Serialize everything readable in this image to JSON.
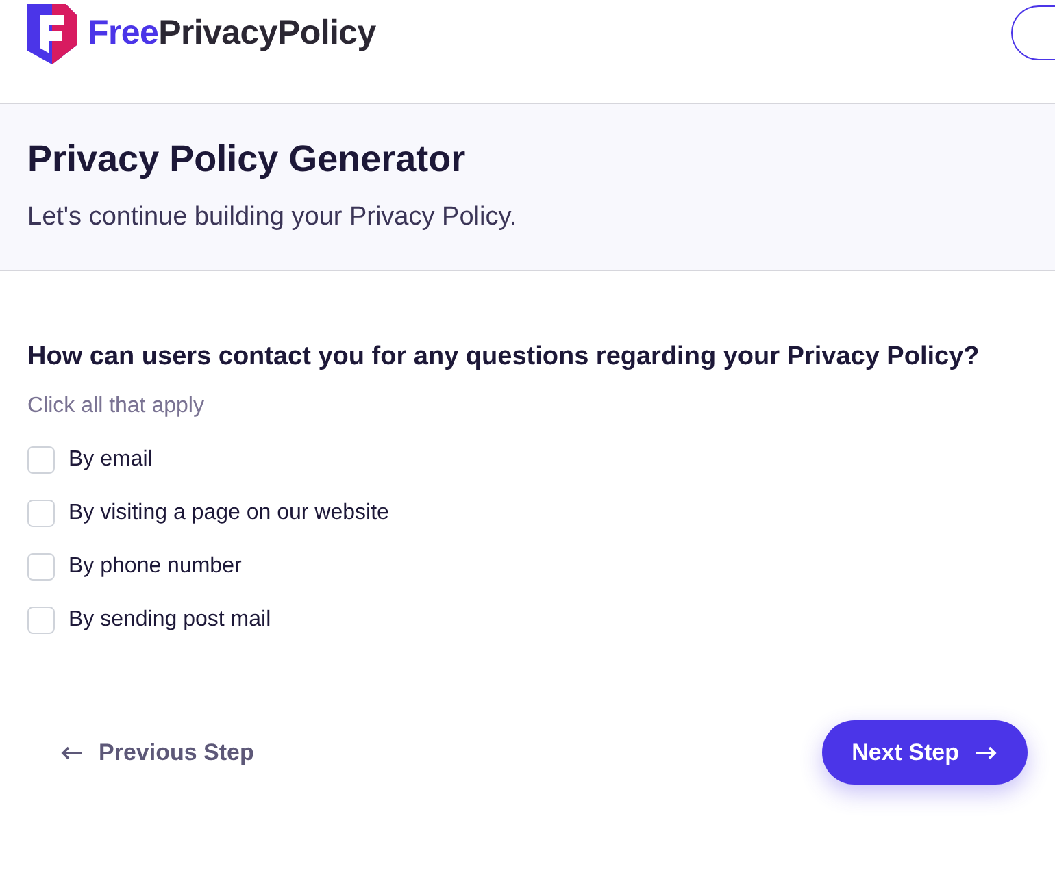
{
  "header": {
    "logo_prefix": "Free",
    "logo_rest": "PrivacyPolicy"
  },
  "banner": {
    "title": "Privacy Policy Generator",
    "subtitle": "Let's continue building your Privacy Policy."
  },
  "question": {
    "title": "How can users contact you for any questions regarding your Privacy Policy?",
    "hint": "Click all that apply",
    "options": [
      {
        "label": "By email",
        "checked": false
      },
      {
        "label": "By visiting a page on our website",
        "checked": false
      },
      {
        "label": "By phone number",
        "checked": false
      },
      {
        "label": "By sending post mail",
        "checked": false
      }
    ]
  },
  "nav": {
    "previous": "Previous Step",
    "next": "Next Step"
  }
}
